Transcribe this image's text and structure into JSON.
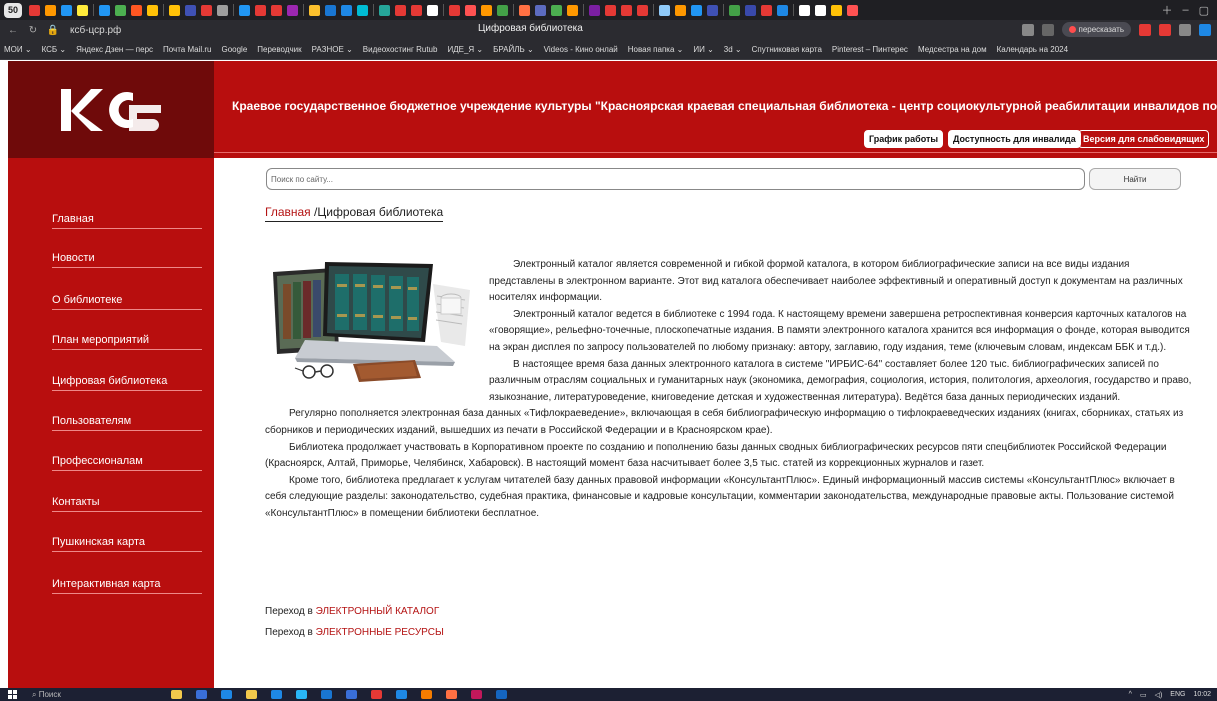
{
  "browser": {
    "tab_count": "50",
    "tab_favicon_colors": [
      "#e53935",
      "#ff9800",
      "#2196f3",
      "#ffeb3b",
      "#2196f3",
      "#4caf50",
      "#ff5722",
      "#ffc107",
      "#ffc107",
      "#3f51b5",
      "#e53935",
      "#9e9e9e",
      "#2196f3",
      "#e53935",
      "#e53935",
      "#9c27b0",
      "#fbc02d",
      "#1976d2",
      "#1e88e5",
      "#00bcd4",
      "#26a69a",
      "#e53935",
      "#e53935",
      "#ffffff",
      "#e53935",
      "#ff5252",
      "#ff9800",
      "#43a047",
      "#ff7043",
      "#5c6bc0",
      "#4caf50",
      "#ff9800",
      "#7b1fa2",
      "#e53935",
      "#e53935",
      "#e53935",
      "#90caf9",
      "#ff9800",
      "#2196f3",
      "#3f51b5",
      "#43a047",
      "#3949ab",
      "#e53935",
      "#1e88e5",
      "#ffffff",
      "#ffffff",
      "#ffc107",
      "#ff5252"
    ],
    "url": "ксб-цср.рф",
    "page_title": "Цифровая библиотека",
    "retell_label": "пересказать",
    "bookmarks": [
      "МОИ ⌄",
      "КСБ ⌄",
      "Яндекс Дзен — перс",
      "Почта Mail.ru",
      "Google",
      "Переводчик",
      "РАЗНОЕ ⌄",
      "Видеохостинг Rutub",
      "ИДЕ_Я ⌄",
      "БРАЙЛЬ ⌄",
      "Videos - Кино онлай",
      "Новая папка ⌄",
      "ИИ ⌄",
      "3d ⌄",
      "Спутниковая карта",
      "Pinterest – Пинтерес",
      "Медсестра на дом",
      "Календарь на 2024"
    ]
  },
  "site": {
    "colors": {
      "primary": "#b80e0e",
      "logo_bg": "#6f0a0a",
      "link": "#b41313"
    },
    "header_title": "Краевое государственное бюджетное учреждение культуры \"Красноярская краевая специальная библиотека - центр социокультурной реабилитации инвалидов по зрению\"",
    "header_buttons": [
      "График работы",
      "Доступность для инвалида",
      "Версия для слабовидящих"
    ],
    "sidebar": [
      "Главная",
      "Новости",
      "О библиотеке",
      "План мероприятий",
      "Цифровая библиотека",
      "Пользователям",
      "Профессионалам",
      "Контакты",
      "Пушкинская карта",
      "Интерактивная карта"
    ],
    "search": {
      "placeholder": "Поиск по сайту...",
      "button": "Найти"
    },
    "breadcrumb": {
      "home": "Главная",
      "separator": " /",
      "current": "Цифровая библиотека"
    },
    "paragraphs": [
      "Электронный каталог является современной и гибкой формой каталога, в котором библиографические записи на все виды издания представлены в электронном варианте. Этот вид каталога обеспечивает наиболее эффективный и оперативный доступ к документам на различных носителях информации.",
      "Электронный каталог ведется в библиотеке с 1994 года. К настоящему времени завершена ретроспективная конверсия карточных каталогов на «говорящие», рельефно-точечные, плоскопечатные издания. В памяти электронного каталога хранится вся информация о фонде, которая выводится на экран дисплея по запросу пользователей по любому признаку: автору, заглавию, году издания, теме (ключевым словам, индексам ББК и т.д.).",
      "В настоящее время база данных электронного каталога в системе \"ИРБИС-64\" составляет более 120 тыс. библиографических записей по различным отраслям социальных и гуманитарных наук (экономика, демография, социология, история, политология, археология, государство и право, языкознание, литературоведение, книговедение детская и художественная литература). Ведётся база данных периодических изданий.",
      "Регулярно пополняется электронная база данных «Тифлокраеведение», включающая в себя библиографическую информацию о тифлокраеведческих изданиях (книгах, сборниках, статьях из сборников и периодических изданий, вышедших из печати в Российской Федерации и в Красноярском крае).",
      "Библиотека продолжает участвовать в Корпоративном проекте по созданию и пополнению базы данных сводных библиографических ресурсов пяти спецбиблиотек Российской Федерации (Красноярск, Алтай, Приморье, Челябинск, Хабаровск). В настоящий момент база насчитывает более 3,5 тыс. статей из коррекционных журналов и газет.",
      "Кроме того, библиотека предлагает к услугам читателей базу данных правовой информации «КонсультантПлюс». Единый информационный массив системы «КонсультантПлюс» включает в себя следующие разделы: законодательство, судебная практика, финансовые и кадровые консультации, комментарии законодательства, международные правовые акты. Пользование системой «КонсультантПлюс» в помещении библиотеки бесплатное."
    ],
    "links": [
      {
        "prefix": "Переход в ",
        "text": "ЭЛЕКТРОННЫЙ КАТАЛОГ"
      },
      {
        "prefix": "Переход в ",
        "text": "ЭЛЕКТРОННЫЕ РЕСУРСЫ"
      }
    ]
  },
  "taskbar": {
    "search_label": "Поиск",
    "icon_colors": [
      "#f2c94c",
      "#3a6fd8",
      "#1e88e5",
      "#f2c94c",
      "#1e88e5",
      "#29b6f6",
      "#1976d2",
      "#3a6fd8",
      "#e53935",
      "#1e88e5",
      "#f57c00",
      "#ff7043",
      "#c2185b",
      "#1565c0"
    ],
    "lang": "ENG",
    "time": "10:02"
  }
}
